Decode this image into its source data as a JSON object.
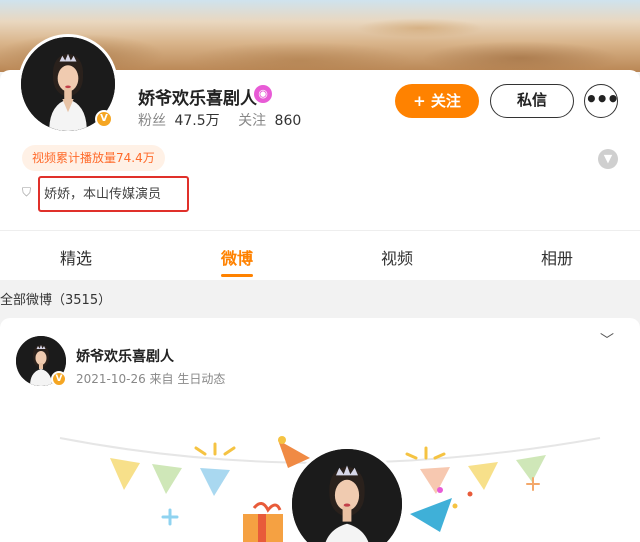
{
  "profile": {
    "nickname": "娇爷欢乐喜剧人",
    "fans_label": "粉丝",
    "fans_value": "47.5万",
    "following_label": "关注",
    "following_value": "860",
    "follow_button": "+ 关注",
    "message_button": "私信",
    "more_button": "•••",
    "play_count_tag": "视频累计播放量74.4万",
    "bio": "娇娇，本山传媒演员"
  },
  "tabs": [
    {
      "label": "精选"
    },
    {
      "label": "微博"
    },
    {
      "label": "视频"
    },
    {
      "label": "相册"
    }
  ],
  "active_tab": "微博",
  "feed": {
    "section_title": "全部微博（3515）",
    "post": {
      "author": "娇爷欢乐喜剧人",
      "meta": "2021-10-26  来自 生日动态"
    }
  },
  "icons": {
    "verified": "verified-badge-icon",
    "vip": "vip-badge-icon",
    "expand": "chevron-down-icon",
    "bio": "shield-icon",
    "post_menu": "chevron-down-icon"
  },
  "colors": {
    "accent": "#ff8200",
    "highlight_box": "#e0302a",
    "verified": "#f5a623",
    "vip": "#e85bd6"
  }
}
